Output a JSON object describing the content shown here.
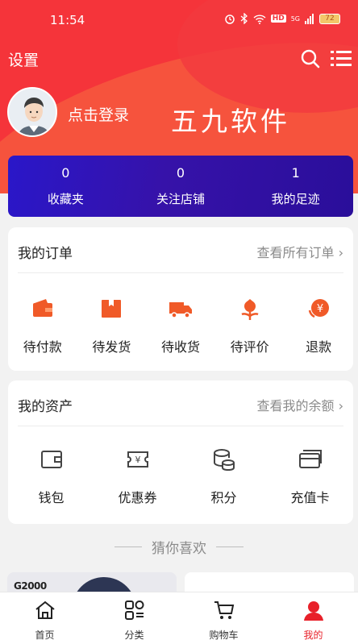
{
  "status_bar": {
    "time": "11:54",
    "battery": "72",
    "network": "5G",
    "hd": "HD"
  },
  "topbar": {
    "settings_label": "设置"
  },
  "profile": {
    "login_label": "点击登录",
    "watermark": "五九软件"
  },
  "stats": [
    {
      "value": "0",
      "label": "收藏夹"
    },
    {
      "value": "0",
      "label": "关注店铺"
    },
    {
      "value": "1",
      "label": "我的足迹"
    }
  ],
  "orders": {
    "title": "我的订单",
    "more": "查看所有订单",
    "items": [
      {
        "label": "待付款",
        "icon": "wallet-icon"
      },
      {
        "label": "待发货",
        "icon": "package-icon"
      },
      {
        "label": "待收货",
        "icon": "truck-icon"
      },
      {
        "label": "待评价",
        "icon": "flower-icon"
      },
      {
        "label": "退款",
        "icon": "refund-icon"
      }
    ]
  },
  "assets": {
    "title": "我的资产",
    "more": "查看我的余额",
    "items": [
      {
        "label": "钱包",
        "icon": "wallet-outline-icon"
      },
      {
        "label": "优惠券",
        "icon": "coupon-icon"
      },
      {
        "label": "积分",
        "icon": "coins-icon"
      },
      {
        "label": "充值卡",
        "icon": "card-icon"
      }
    ]
  },
  "guess_label": "猜你喜欢",
  "product_brand": "G2000",
  "tabs": [
    {
      "label": "首页",
      "icon": "home-icon",
      "active": false
    },
    {
      "label": "分类",
      "icon": "category-icon",
      "active": false
    },
    {
      "label": "购物车",
      "icon": "cart-icon",
      "active": false
    },
    {
      "label": "我的",
      "icon": "user-icon",
      "active": true
    }
  ],
  "colors": {
    "brand_red": "#f5343a",
    "stats_blue": "#2a17c9",
    "icon_orange": "#f05a28",
    "tab_active": "#e8212a"
  }
}
